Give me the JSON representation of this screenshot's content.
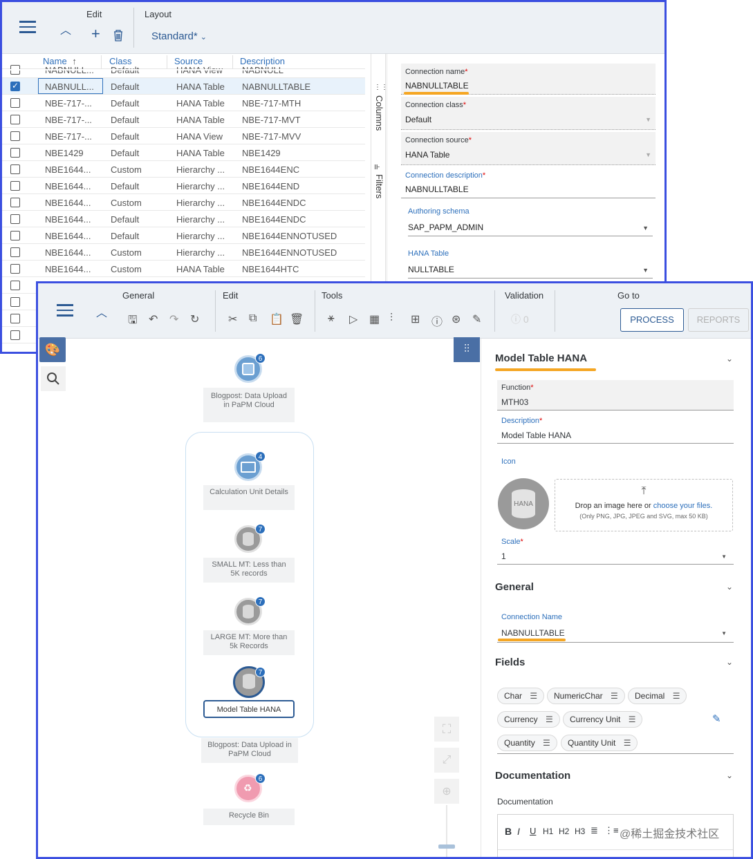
{
  "w1": {
    "toolbar": {
      "edit_label": "Edit",
      "layout_label": "Layout",
      "layout_value": "Standard*"
    },
    "columns": [
      "Name",
      "Class",
      "Source",
      "Description"
    ],
    "rows": [
      {
        "name": "NABNULL...",
        "class": "Default",
        "source": "HANA View",
        "desc": "NABNULL"
      },
      {
        "name": "NABNULL...",
        "class": "Default",
        "source": "HANA Table",
        "desc": "NABNULLTABLE"
      },
      {
        "name": "NBE-717-...",
        "class": "Default",
        "source": "HANA Table",
        "desc": "NBE-717-MTH"
      },
      {
        "name": "NBE-717-...",
        "class": "Default",
        "source": "HANA Table",
        "desc": "NBE-717-MVT"
      },
      {
        "name": "NBE-717-...",
        "class": "Default",
        "source": "HANA View",
        "desc": "NBE-717-MVV"
      },
      {
        "name": "NBE1429",
        "class": "Default",
        "source": "HANA Table",
        "desc": "NBE1429"
      },
      {
        "name": "NBE1644...",
        "class": "Custom",
        "source": "Hierarchy ...",
        "desc": "NBE1644ENC"
      },
      {
        "name": "NBE1644...",
        "class": "Default",
        "source": "Hierarchy ...",
        "desc": "NBE1644END"
      },
      {
        "name": "NBE1644...",
        "class": "Custom",
        "source": "Hierarchy ...",
        "desc": "NBE1644ENDC"
      },
      {
        "name": "NBE1644...",
        "class": "Default",
        "source": "Hierarchy ...",
        "desc": "NBE1644ENDC"
      },
      {
        "name": "NBE1644...",
        "class": "Default",
        "source": "Hierarchy ...",
        "desc": "NBE1644ENNOTUSED"
      },
      {
        "name": "NBE1644...",
        "class": "Custom",
        "source": "Hierarchy ...",
        "desc": "NBE1644ENNOTUSED"
      },
      {
        "name": "NBE1644...",
        "class": "Custom",
        "source": "HANA Table",
        "desc": "NBE1644HTC"
      }
    ],
    "side_tabs": {
      "columns": "Columns",
      "filters": "Filters"
    },
    "form": {
      "conn_name_label": "Connection name",
      "conn_name": "NABNULLTABLE",
      "conn_class_label": "Connection class",
      "conn_class": "Default",
      "conn_source_label": "Connection source",
      "conn_source": "HANA Table",
      "conn_desc_label": "Connection description",
      "conn_desc": "NABNULLTABLE",
      "schema_label": "Authoring schema",
      "schema": "SAP_PAPM_ADMIN",
      "table_label": "HANA Table",
      "table": "NULLTABLE"
    }
  },
  "w2": {
    "toolbar": {
      "general": "General",
      "edit": "Edit",
      "tools": "Tools",
      "validation": "Validation",
      "validation_count": "0",
      "goto": "Go to",
      "process": "PROCESS",
      "reports": "REPORTS"
    },
    "nodes": {
      "top": {
        "label": "Blogpost: Data Upload in PaPM Cloud",
        "badge": "6"
      },
      "calc": {
        "label": "Calculation Unit Details",
        "badge": "4"
      },
      "small": {
        "label": "SMALL MT: Less than 5K records",
        "badge": "7"
      },
      "large": {
        "label": "LARGE MT: More than 5k Records",
        "badge": "7"
      },
      "model": {
        "label": "Model Table HANA",
        "badge": "7"
      },
      "group": {
        "label": "Blogpost: Data Upload in PaPM Cloud"
      },
      "recycle": {
        "label": "Recycle Bin",
        "badge": "6"
      }
    },
    "panel": {
      "title": "Model Table HANA",
      "function_label": "Function",
      "function": "MTH03",
      "desc_label": "Description",
      "desc": "Model Table HANA",
      "icon_label": "Icon",
      "icon_text": "HANA",
      "drop_text": "Drop an image here or ",
      "drop_link": "choose your files.",
      "drop_note": "(Only PNG, JPG, JPEG and SVG, max 50 KB)",
      "scale_label": "Scale",
      "scale": "1",
      "general_h": "General",
      "conn_label": "Connection Name",
      "conn": "NABNULLTABLE",
      "fields_h": "Fields",
      "tags": [
        "Char",
        "NumericChar",
        "Decimal",
        "Currency",
        "Currency Unit",
        "Quantity",
        "Quantity Unit"
      ],
      "doc_h": "Documentation",
      "doc_label": "Documentation",
      "rte": [
        "B",
        "I",
        "U",
        "H1",
        "H2",
        "H3"
      ],
      "watermark": "@稀土掘金技术社区"
    }
  },
  "colors": {
    "border": "#3b4fe0",
    "accent": "#2c6fbb",
    "highlight": "#f5a623"
  }
}
